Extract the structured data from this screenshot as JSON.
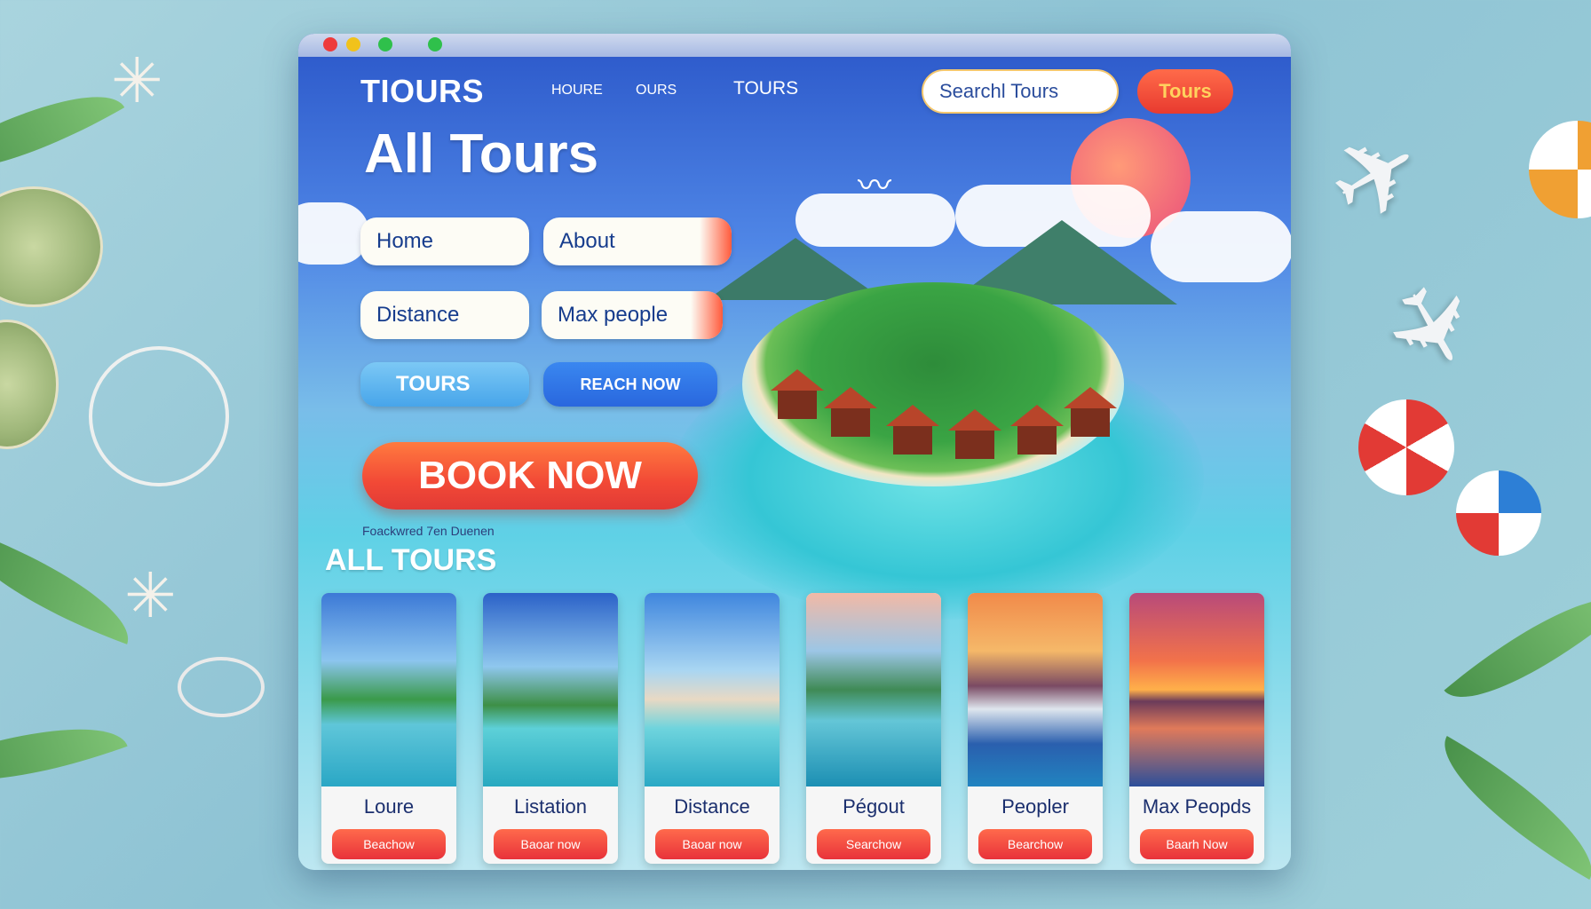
{
  "header": {
    "logo": "TIOURS",
    "nav": [
      "HOURE",
      "OURS",
      "TOURS"
    ],
    "search_placeholder": "Searchl Tours",
    "tours_button": "Tours"
  },
  "hero": {
    "title": "All Tours",
    "buttons": [
      "Home",
      "About",
      "Distance",
      "Max people",
      "TOURS",
      "REACH NOW"
    ],
    "book_now": "BOOK NOW",
    "tiny_text": "Foackwred 7en Duenen"
  },
  "section": {
    "title": "ALL TOURS"
  },
  "cards": [
    {
      "label": "Loure",
      "button": "Beachow"
    },
    {
      "label": "Listation",
      "button": "Baoar now"
    },
    {
      "label": "Distance",
      "button": "Baoar now"
    },
    {
      "label": "Pégout",
      "button": "Searchow"
    },
    {
      "label": "Peopler",
      "button": "Bearchow"
    },
    {
      "label": "Max Peopds",
      "button": "Baarh Now"
    }
  ],
  "colors": {
    "accent": "#f24936",
    "brand_blue": "#2b57c9",
    "label_blue": "#163c8d"
  }
}
